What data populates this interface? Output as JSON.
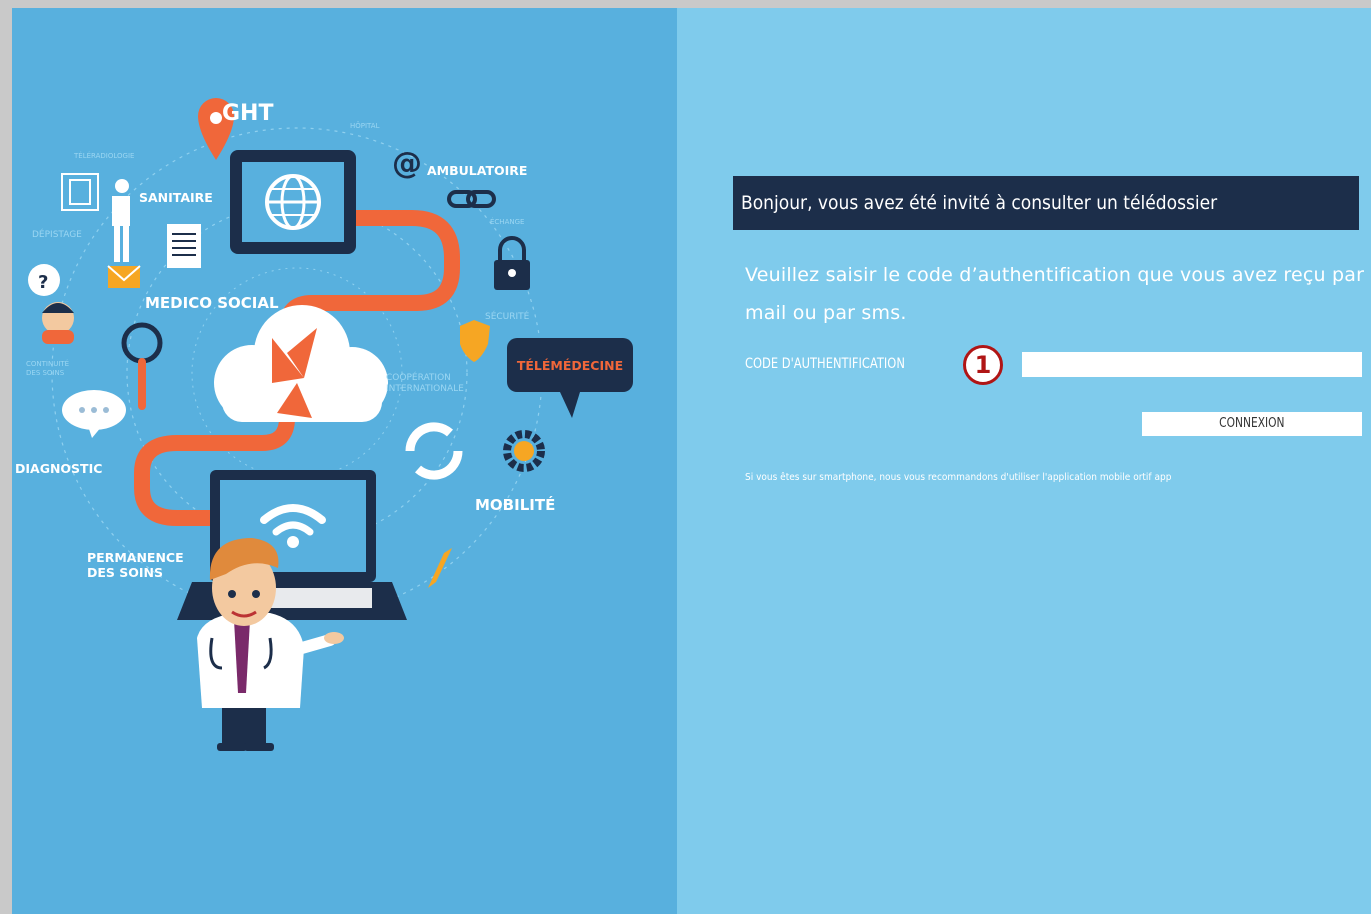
{
  "illustration": {
    "labels": {
      "ght": "GHT",
      "ambulatoire": "AMBULATOIRE",
      "sanitaire": "SANITAIRE",
      "medico_social": "MEDICO SOCIAL",
      "telemedecine": "TÉLÉMÉDECINE",
      "diagnostic": "DIAGNOSTIC",
      "mobilite": "MOBILITÉ",
      "permanence_line1": "PERMANENCE",
      "permanence_line2": "DES SOINS",
      "hopital": "HÔPITAL",
      "teleradiologie": "TÉLÉRADIOLOGIE",
      "depistage": "DÉPISTAGE",
      "securite": "SÉCURITÉ",
      "echange": "ÉCHANGE",
      "cooperation_internationale_1": "COOPÉRATION",
      "cooperation_internationale_2": "INTERNATIONALE",
      "continuite_1": "CONTINUITÉ",
      "continuite_2": "DES SOINS"
    }
  },
  "auth": {
    "title": "Bonjour, vous avez été invité à consulter un télédossier",
    "instruction": "Veuillez saisir le code d’authentification que vous avez reçu par mail ou par sms.",
    "code_label": "CODE D'AUTHENTIFICATION",
    "step_badge": "1",
    "code_value": "",
    "connect_label": "CONNEXION",
    "smartphone_note": "Si vous êtes sur smartphone, nous vous recommandons d'utiliser l'application mobile ortif app"
  },
  "colors": {
    "left_bg": "#58b0de",
    "right_bg": "#7fcbec",
    "title_bar": "#1c2e4a",
    "accent_orange": "#f0673a",
    "badge_red": "#b01515"
  }
}
